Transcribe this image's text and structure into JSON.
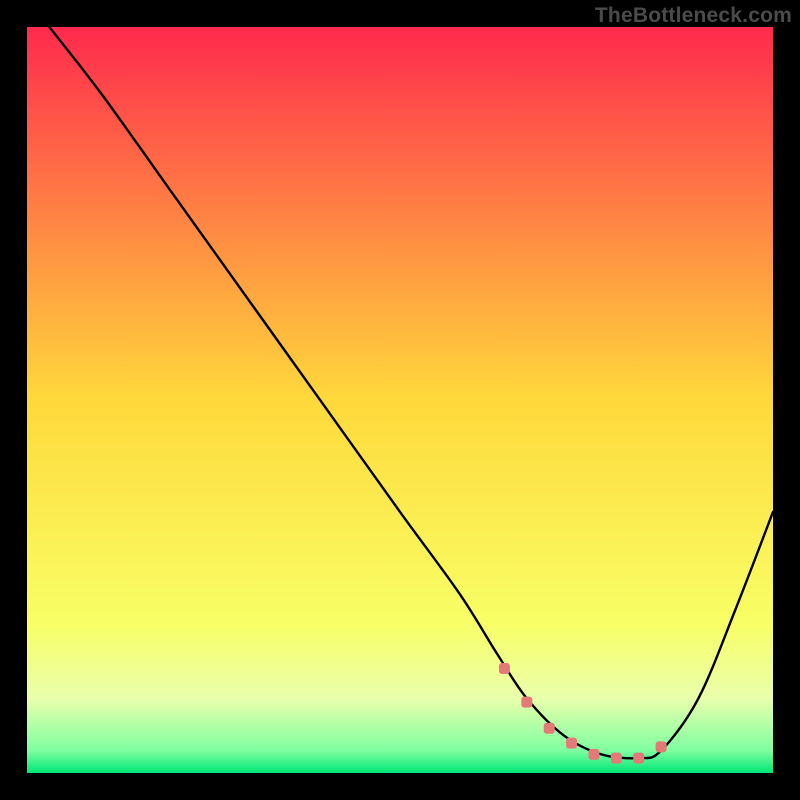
{
  "watermark": "TheBottleneck.com",
  "chart_data": {
    "type": "line",
    "title": "",
    "xlabel": "",
    "ylabel": "",
    "xlim": [
      0,
      100
    ],
    "ylim": [
      0,
      100
    ],
    "grid": false,
    "legend": false,
    "background_gradient": {
      "stops": [
        {
          "offset": 0.0,
          "color": "#ff2a4d"
        },
        {
          "offset": 0.5,
          "color": "#ffd93b"
        },
        {
          "offset": 0.8,
          "color": "#f8ff66"
        },
        {
          "offset": 0.9,
          "color": "#eaffac"
        },
        {
          "offset": 0.97,
          "color": "#7effa0"
        },
        {
          "offset": 1.0,
          "color": "#00e676"
        }
      ]
    },
    "series": [
      {
        "name": "curve",
        "type": "line",
        "color": "#000000",
        "x": [
          3,
          10,
          20,
          30,
          40,
          50,
          58,
          63,
          67,
          72,
          77,
          82,
          85,
          90,
          95,
          100
        ],
        "y": [
          100,
          91,
          77,
          63,
          49,
          35,
          24,
          16,
          10,
          5,
          2.5,
          2,
          3,
          10,
          22,
          35
        ]
      },
      {
        "name": "markers",
        "type": "scatter",
        "color": "#e47a78",
        "x": [
          64,
          67,
          70,
          73,
          76,
          79,
          82,
          85
        ],
        "y": [
          14,
          9.5,
          6,
          4,
          2.5,
          2,
          2,
          3.5
        ]
      }
    ]
  }
}
